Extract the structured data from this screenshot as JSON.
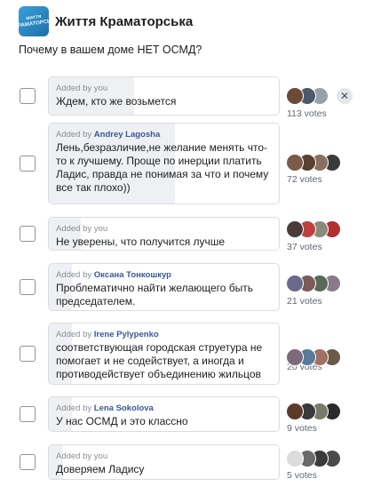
{
  "header": {
    "group_name": "Життя Краматорська",
    "logo_text": "життя КРАМАТОРСЬК"
  },
  "poll": {
    "question": "Почему в вашем доме НЕТ ОСМД?",
    "added_prefix": "Added by",
    "options": [
      {
        "added_by": "you",
        "is_you": true,
        "text": "Ждем, кто же возьмется",
        "votes": "113 votes",
        "vote_share": 0.37,
        "avatars": [
          "#6b4a3a",
          "#4a5a6a",
          "#9aa0a6"
        ],
        "removable": true
      },
      {
        "added_by": "Andrey Lagosha",
        "is_you": false,
        "text": "Лень,безразличие,не желание менять что-то к лучшему. Проще по инерции платить Ладис, правда не понимая за что и почему все так плохо))",
        "votes": "72 votes",
        "vote_share": 0.55,
        "avatars": [
          "#7a5a4a",
          "#5a4030",
          "#8a7060",
          "#3a3a3a"
        ],
        "removable": false
      },
      {
        "added_by": "you",
        "is_you": true,
        "text": "Не уверены, что получится лучше",
        "votes": "37 votes",
        "vote_share": 0.14,
        "avatars": [
          "#4a3a3a",
          "#c04040",
          "#8a8a7a",
          "#b03030"
        ],
        "removable": false
      },
      {
        "added_by": "Оксана Тонкошкур",
        "is_you": false,
        "text": "Проблематично найти желающего быть председателем.",
        "votes": "21 votes",
        "vote_share": 0.1,
        "avatars": [
          "#6a6a8a",
          "#7a5a5a",
          "#5a6a5a",
          "#8a7a8a"
        ],
        "removable": false
      },
      {
        "added_by": "Irene Pylypenko",
        "is_you": false,
        "text": "соответствующая городская струетура не помогает и не содействует, а иногда и противодействует объединению жильцов",
        "votes": "20 votes",
        "vote_share": 0.1,
        "avatars": [
          "#7a6a7a",
          "#5a7a9a",
          "#a07060",
          "#6a5a4a"
        ],
        "removable": false
      },
      {
        "added_by": "Lena Sokolova",
        "is_you": false,
        "text": "У нас ОСМД и это классно",
        "votes": "9 votes",
        "vote_share": 0.1,
        "avatars": [
          "#5a3a2a",
          "#3a3a3a",
          "#7a7a6a",
          "#2a2a2a"
        ],
        "removable": false
      },
      {
        "added_by": "you",
        "is_you": true,
        "text": "Доверяем Ладису",
        "votes": "5 votes",
        "vote_share": 0.06,
        "avatars": [
          "#dcdcdc",
          "#6a6a6a",
          "#3a3a3a",
          "#4a4a4a"
        ],
        "removable": false
      }
    ]
  },
  "colors": {
    "link": "#385898",
    "border": "#dadde1",
    "vote_bar": "#eef0f3"
  },
  "icons": {
    "remove": "close-icon"
  }
}
